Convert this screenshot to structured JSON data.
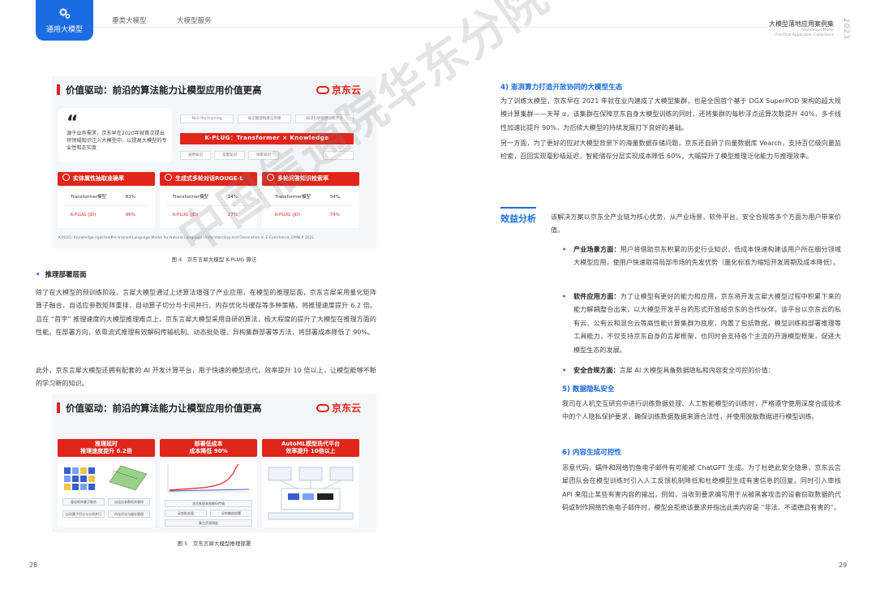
{
  "header": {
    "badge_label": "通用大模型",
    "tab1": "垂类大模型",
    "tab2": "大模型服务",
    "right_title": "大模型落地应用案例集",
    "right_sub1": "Foundation Model",
    "right_sub2": "Practical Application Collections",
    "year": "2023"
  },
  "watermark": "中国信通院华东分院",
  "figure4": {
    "title": "价值驱动：前沿的算法能力让模型应用价值更高",
    "logo": "京东云",
    "quote": "源于业务需求，京东早在2020年就首次提出将领域知识注入大模型中，以提高大模型的专业性和正实度",
    "pills_top": [
      "NLG Pre-training",
      "知识图谱构建与存储",
      "知识引导的预训练学习"
    ],
    "kplug": "K-PLUG：Transformer × Knowledge",
    "pills_bottom": [
      "通用知识",
      "常量知识",
      "场景知识",
      "..."
    ],
    "panels": [
      {
        "head": "实体属性抽取准确率",
        "rows": [
          {
            "k": "Transformer模型",
            "v": "83%"
          },
          {
            "k": "K-PLUG (JD)",
            "v": "96%"
          }
        ]
      },
      {
        "head": "生成式多轮对话ROUGE-L",
        "rows": [
          {
            "k": "Transformer模型",
            "v": "24%"
          },
          {
            "k": "K-PLUG (JD)",
            "v": "27%"
          }
        ]
      },
      {
        "head": "多轮问答知识检索率",
        "rows": [
          {
            "k": "Transformer模型",
            "v": "54%"
          },
          {
            "k": "K-PLUG (JD)",
            "v": "74%"
          }
        ]
      }
    ],
    "footnote": "K-PLUG: Knowledge-injected Pre-trained Language Model for Natural Language Understanding and Generation in E-Commerce, EMNLP 2021",
    "caption": "图 4　京东言犀大模型 K-PLUG 算法"
  },
  "left": {
    "section_title": "推理部署层面",
    "para1": "除了在大模型的预训练阶段，言犀大模型通过上述算法增强了产业应用，在模型的推理层面，京东言犀采用量化矩阵算子融合，自适应参数矩阵重排，自动算子切分与卡间并行、内存优化与缓存等多种策略，将推理速度提升 6.2 倍。且在 “首字” 推理速度的大模型推理难点上，京东言犀大模型采用自研的算法，极大程度的提升了大模型在推理方面的性能。在部署方向，依靠流式推理有效解码传输机制、动态批处理、异构集群部署等方法，将部署成本降低了 90%。",
    "para2": "此外，京东言犀大模型还拥有配套的 AI 开发计算平台，用于快速的模型迭代，效率提升 10 倍以上，让模型能够不断的学习新的知识。",
    "page_number": "28"
  },
  "figure5": {
    "title": "价值驱动：前沿的算法能力让模型应用价值更高",
    "logo": "京东云",
    "panels": [
      {
        "line1": "推理延时",
        "line2": "推理速度提升 6.2倍"
      },
      {
        "line1": "部署低成本",
        "line2": "成本降低 90%"
      },
      {
        "line1": "AutoML模型迭代平台",
        "line2": "效率提升 10倍以上"
      }
    ],
    "p1_labels": [
      "量化矩阵算子融合",
      "自适应参数矩阵重排",
      "自动算子切分与卡间并行",
      "内存优化与缓存管理"
    ],
    "p2_labels": [
      "流式推理高效解码传输",
      "动态批处理",
      "异构集群部署",
      "算力资源调度"
    ],
    "caption": "图 5　京东言犀大模型推理部署"
  },
  "right": {
    "h4": "4) 澎湃算力打造开放协同的大模型生态",
    "para_a": "为了训练大模型，京东早在 2021 年就在业内建成了大模型集群，也是全国首个基于 DGX SuperPOD 架构的超大规模计算集群——天琴 α，该集群在保障京东自身大模型训练的同时，还将集群的每秒浮点运算次数提升 40%，多卡线性加速比提升 90%，为后续大模型的持续发展打下良好的基础。",
    "para_b": "另一方面，为了更好的应对大模型背景下的海量数据存储问题，京东还自研了向量数据库 Vearch，支持百亿级向量监检索，召回实现毫秒级延迟，智能储存分层实现成本降低 60%，大幅提升了模型推理泛化能力与推理效率。",
    "benefit_label": "效益分析",
    "benefit_intro": "该解决方案以京东全产业链为核心优势，从产业场景，软件平台，安全合规等多个方面为用户带来价值。",
    "bullets": [
      {
        "title": "产业场景方面：",
        "text": "用户将借助京东积累的历史行业知识，低成本快速构建该用户所在细分领域大模型应用，使用户快速取得局部市场的先发优势（量化标准为缩短开发周期及成本降低）。"
      },
      {
        "title": "软件应用方面：",
        "text": "为了让模型有更好的能力和应用，京东将开发言犀大模型过程中积累下来的能力解耦整合出来，以大模型开发平台的形式开放给京东的合作伙伴。该平台以京东云的私有云、公有云和混合云等高性能计算集群为底座，内置了包括数据，模型训练和部署推理等工具能力，不仅支持京东自身的言犀框架，也同时会支持各个主流的开源模型框架，促进大模型生态的发展。"
      },
      {
        "title": "安全合规方面：",
        "text": "言犀 AI 大模型具备数据隐私和内容安全可控的价值："
      }
    ],
    "h5": "5) 数据隐私安全",
    "para5": "我司在人机交互研究中进行训练数据处理、人工智能模型的训练时，严格遵守使用深度合成技术中的个人隐私保护要求，确保训练数据数据来源合法性，并使用脱敏数据进行模型训练。",
    "h6": "6) 内容生成可控性",
    "para6": "恶意代码，蠕件和网络钓鱼电子邮件有可能被 ChatGPT 生成。为了杜绝此安全隐患，京东云言犀团队会在模型训练时引入人工反馈机制降低和杜绝模型生成有害信息的回复。同时引入审核 API 来阻止某些有害内容的输出，例如，当收到要求编写用于从被黑客攻击的设备窃取数据的代码或制作网络钓鱼电子邮件时，模型会拒绝该要求并指出此类内容是 “非法、不道德且有害的”。",
    "page_number": "29"
  },
  "colors": {
    "accent_blue": "#1b6ce0",
    "jd_red": "#e1251b"
  }
}
